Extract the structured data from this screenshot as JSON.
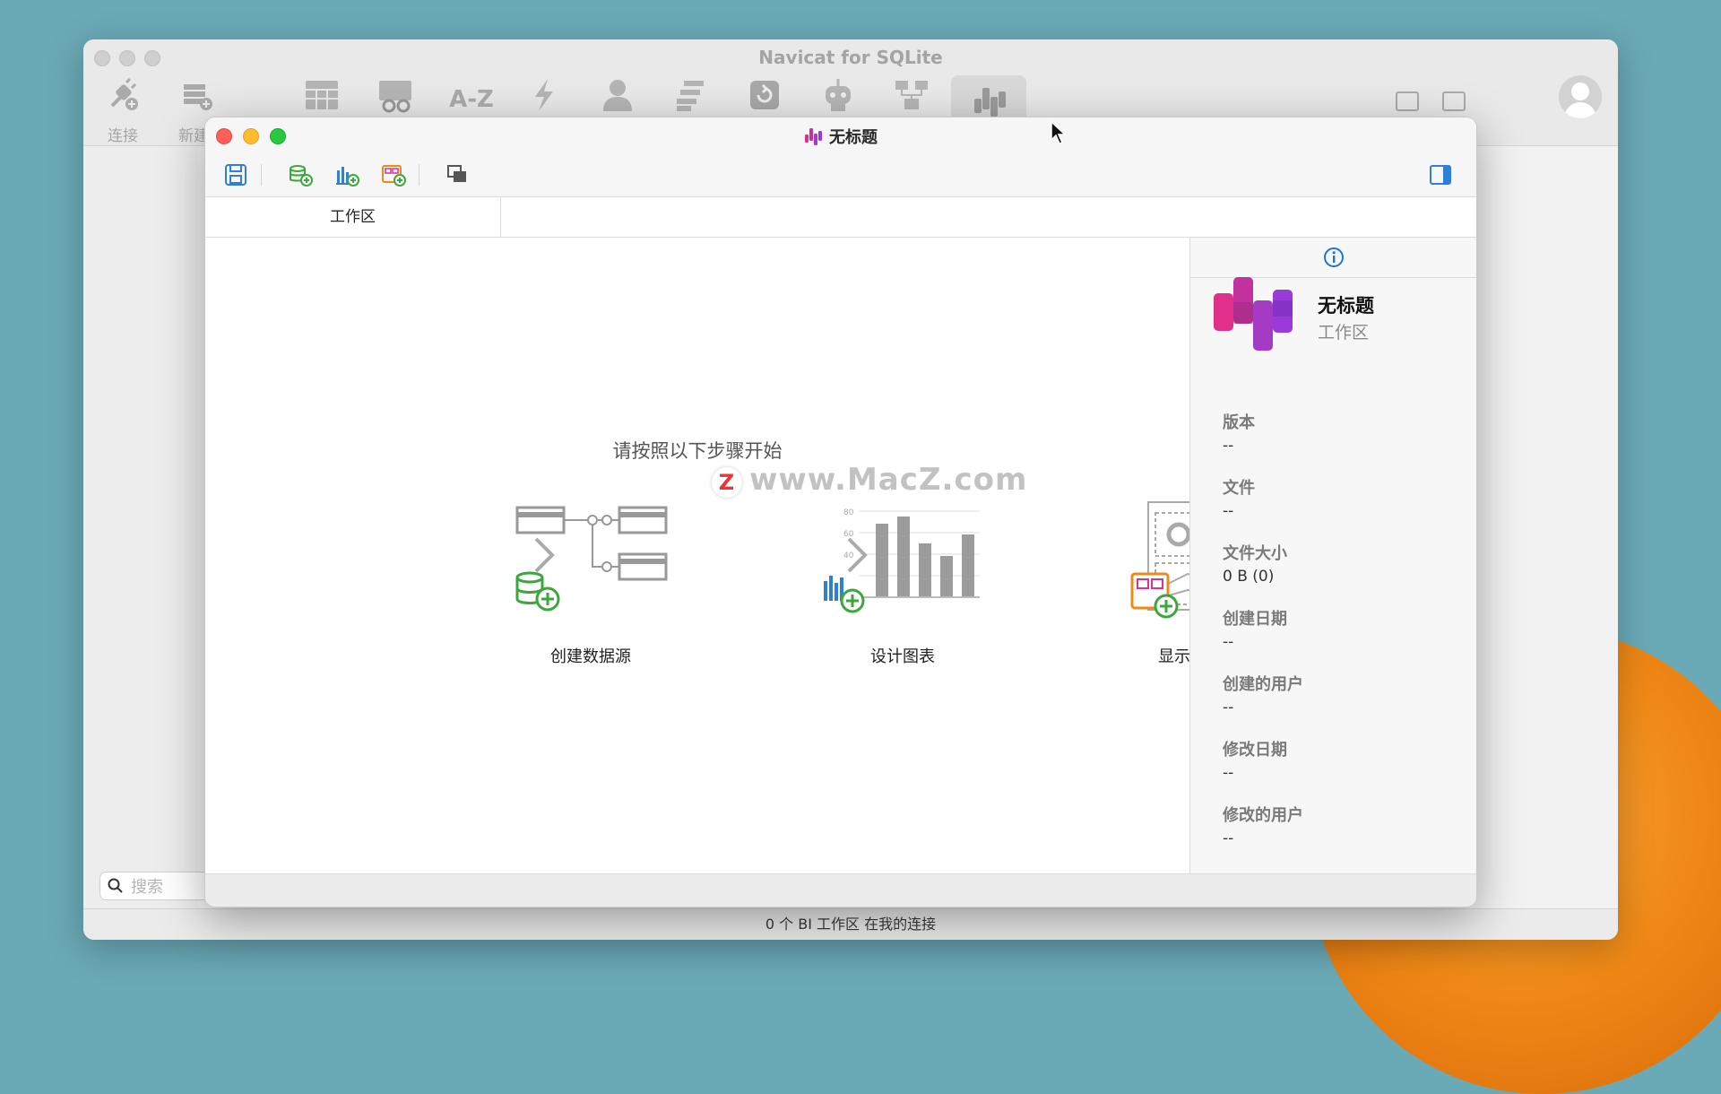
{
  "background_app": {
    "title": "Navicat for SQLite",
    "toolbar": [
      {
        "label": "连接",
        "icon": "plug-icon"
      },
      {
        "label": "新建查询",
        "icon": "new-query-icon"
      },
      {
        "label": "",
        "icon": "table-icon"
      },
      {
        "label": "",
        "icon": "view-icon"
      },
      {
        "label": "A-Z",
        "icon": "az-icon"
      },
      {
        "label": "",
        "icon": "function-icon"
      },
      {
        "label": "",
        "icon": "user-icon"
      },
      {
        "label": "",
        "icon": "query-icon"
      },
      {
        "label": "",
        "icon": "backup-icon"
      },
      {
        "label": "",
        "icon": "automation-icon"
      },
      {
        "label": "",
        "icon": "model-icon"
      },
      {
        "label": "",
        "icon": "bi-icon"
      }
    ],
    "search_placeholder": "搜索",
    "status": "0 个 BI 工作区 在我的连接"
  },
  "window": {
    "title": "无标题",
    "tab": "工作区"
  },
  "main": {
    "steps_title": "请按照以下步骤开始",
    "watermark": "www.MacZ.com",
    "watermark_mark": "Z",
    "steps": [
      {
        "label": "创建数据源"
      },
      {
        "label": "设计图表"
      },
      {
        "label": "显示你的仪表板"
      }
    ],
    "chart_ticks": [
      "80",
      "60",
      "40"
    ]
  },
  "side": {
    "name": "无标题",
    "type": "工作区",
    "props": [
      {
        "key": "版本",
        "value": "--"
      },
      {
        "key": "文件",
        "value": "--"
      },
      {
        "key": "文件大小",
        "value": "0 B (0)"
      },
      {
        "key": "创建日期",
        "value": "--"
      },
      {
        "key": "创建的用户",
        "value": "--"
      },
      {
        "key": "修改日期",
        "value": "--"
      },
      {
        "key": "修改的用户",
        "value": "--"
      }
    ]
  },
  "colors": {
    "accent_blue": "#1a73e8",
    "brand_pink": "#e0308a",
    "brand_purple": "#9a3ad8",
    "green": "#3aa83a"
  }
}
